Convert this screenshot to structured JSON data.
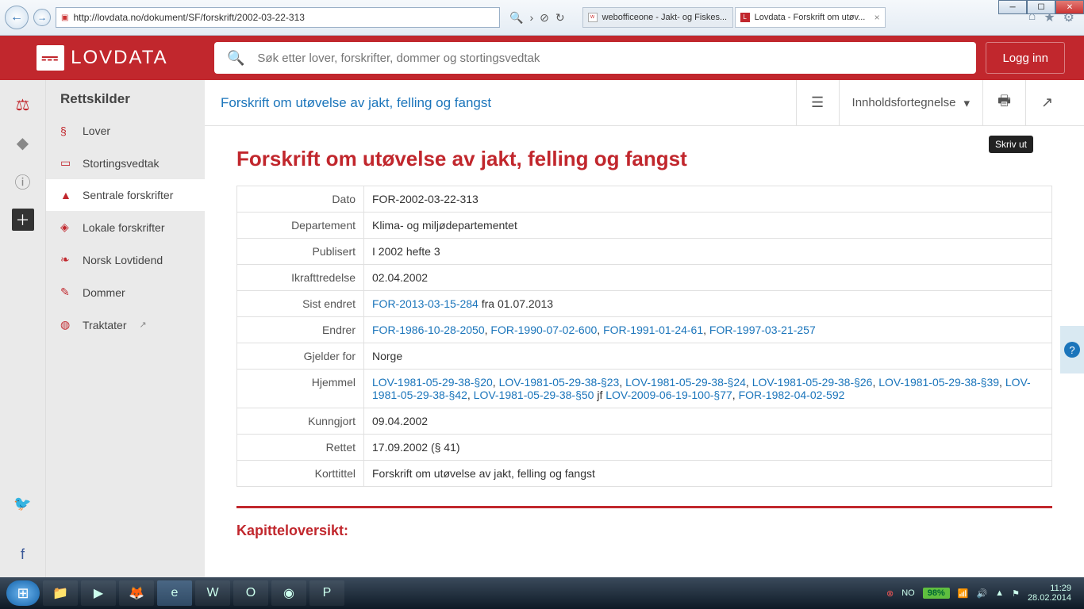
{
  "browser": {
    "url": "http://lovdata.no/dokument/SF/forskrift/2002-03-22-313",
    "tabs": [
      {
        "label": "webofficeone - Jakt- og Fiskes...",
        "active": false
      },
      {
        "label": "Lovdata - Forskrift om utøv...",
        "active": true
      }
    ]
  },
  "header": {
    "logo_text": "LOVDATA",
    "search_placeholder": "Søk etter lover, forskrifter, dommer og stortingsvedtak",
    "login_label": "Logg inn"
  },
  "sidebar": {
    "title": "Rettskilder",
    "items": [
      {
        "icon": "§",
        "label": "Lover"
      },
      {
        "icon": "▭",
        "label": "Stortingsvedtak"
      },
      {
        "icon": "▲",
        "label": "Sentrale forskrifter",
        "selected": true
      },
      {
        "icon": "◈",
        "label": "Lokale forskrifter"
      },
      {
        "icon": "❧",
        "label": "Norsk Lovtidend"
      },
      {
        "icon": "✎",
        "label": "Dommer"
      },
      {
        "icon": "◍",
        "label": "Traktater",
        "external": true
      }
    ]
  },
  "doc": {
    "breadcrumb": "Forskrift om utøvelse av jakt, felling og fangst",
    "toc_label": "Innholdsfortegnelse",
    "print_tooltip": "Skriv ut",
    "title": "Forskrift om utøvelse av jakt, felling og fangst",
    "chapter_heading": "Kapitteloversikt:",
    "meta": {
      "Dato": "FOR-2002-03-22-313",
      "Departement": "Klima- og miljødepartementet",
      "Publisert": "I 2002 hefte 3",
      "Ikrafttredelse": "02.04.2002",
      "Sist endret": {
        "link": "FOR-2013-03-15-284",
        "suffix": " fra 01.07.2013"
      },
      "Endrer": [
        "FOR-1986-10-28-2050",
        "FOR-1990-07-02-600",
        "FOR-1991-01-24-61",
        "FOR-1997-03-21-257"
      ],
      "Gjelder for": "Norge",
      "Hjemmel": {
        "links": [
          "LOV-1981-05-29-38-§20",
          "LOV-1981-05-29-38-§23",
          "LOV-1981-05-29-38-§24",
          "LOV-1981-05-29-38-§26",
          "LOV-1981-05-29-38-§39",
          "LOV-1981-05-29-38-§42",
          "LOV-1981-05-29-38-§50"
        ],
        "jf": " jf ",
        "jf_links": [
          "LOV-2009-06-19-100-§77",
          "FOR-1982-04-02-592"
        ]
      },
      "Kunngjort": "09.04.2002",
      "Rettet": "17.09.2002 (§ 41)",
      "Korttittel": "Forskrift om utøvelse av jakt, felling og fangst"
    }
  },
  "taskbar": {
    "lang": "NO",
    "battery": "98%",
    "time": "11:29",
    "date": "28.02.2014"
  }
}
